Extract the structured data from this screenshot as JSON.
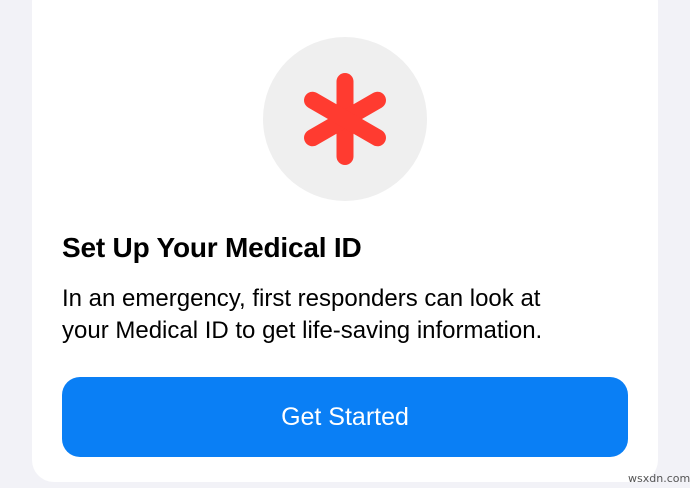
{
  "medical_id": {
    "icon": "medical-asterisk-icon",
    "icon_color": "#ff3b30",
    "title": "Set Up Your Medical ID",
    "description_lines": [
      "In an emergency, first responders can look at",
      "your Medical ID to get life-saving information."
    ],
    "cta_label": "Get Started",
    "cta_color": "#0a7ff5"
  },
  "watermark": "wsxdn.com"
}
